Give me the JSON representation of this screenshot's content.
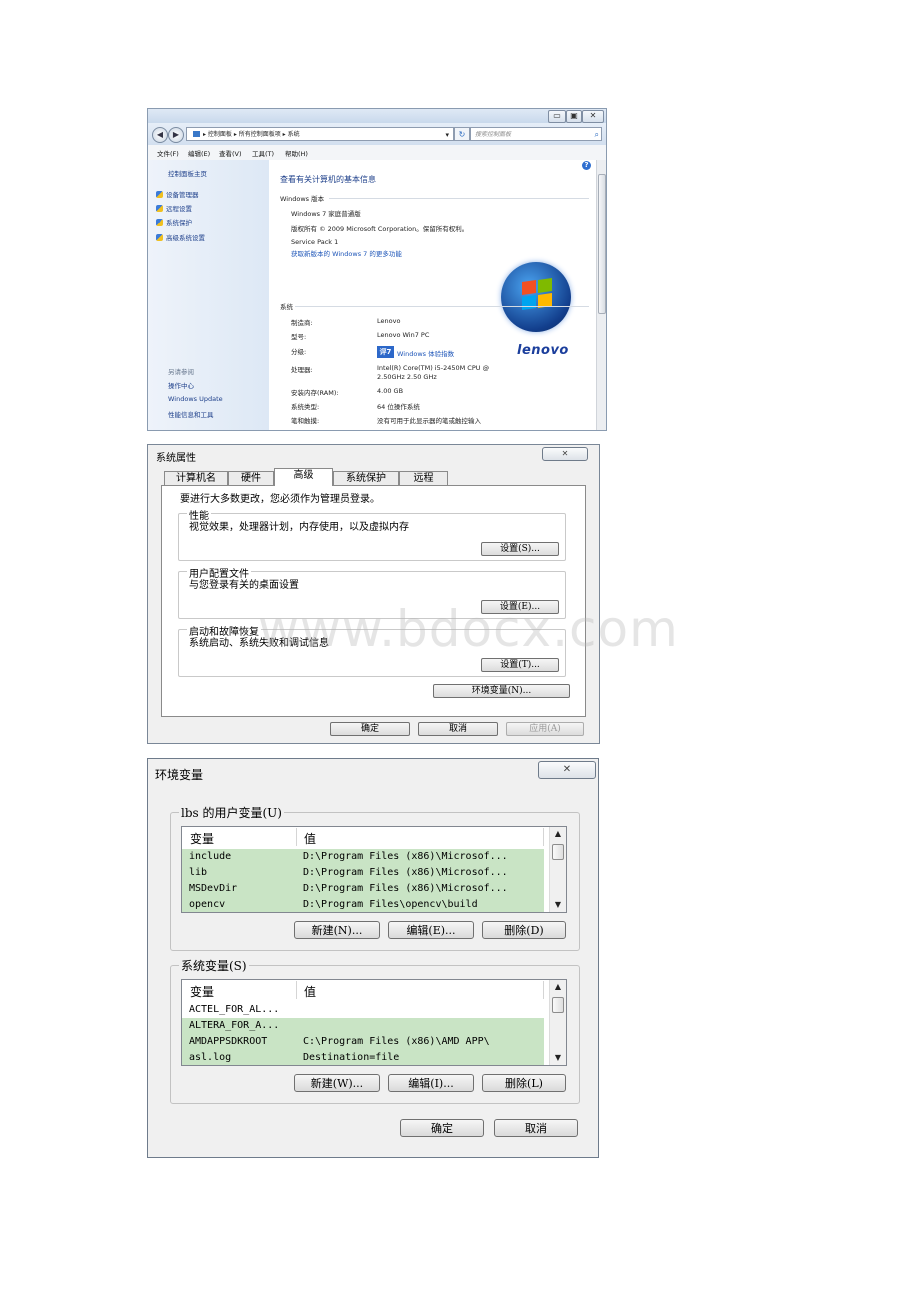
{
  "window1": {
    "caption": {
      "minimize": "▭",
      "maximize": "▣",
      "close": "✕"
    },
    "nav": {
      "back": "◀",
      "forward": "▶",
      "recent": "▾"
    },
    "address_path": "▸ 控制面板 ▸ 所有控制面板项 ▸ 系统",
    "search_placeholder": "搜索控制面板",
    "menu": [
      "文件(F)",
      "编辑(E)",
      "查看(V)",
      "工具(T)",
      "帮助(H)"
    ],
    "sidebar": {
      "home": "控制面板主页",
      "links": [
        "设备管理器",
        "远程设置",
        "系统保护",
        "高级系统设置"
      ],
      "see_also": "另请参阅",
      "bottom_links": [
        "操作中心",
        "Windows Update",
        "性能信息和工具"
      ]
    },
    "title": "查看有关计算机的基本信息",
    "edition_header": "Windows 版本",
    "edition": "Windows 7 家庭普通版",
    "copyright": "版权所有 © 2009 Microsoft Corporation。保留所有权利。",
    "service_pack": "Service Pack 1",
    "upgrade_link": "获取新版本的 Windows 7 的更多功能",
    "system_header": "系统",
    "system_rows": [
      {
        "label": "制造商:",
        "value": "Lenovo"
      },
      {
        "label": "型号:",
        "value": "Lenovo Win7 PC"
      },
      {
        "label": "分级:",
        "value": "Windows 体验指数"
      },
      {
        "label": "处理器:",
        "value": "Intel(R) Core(TM) i5-2450M CPU @ 2.50GHz   2.50 GHz"
      },
      {
        "label": "安装内存(RAM):",
        "value": "4.00 GB"
      },
      {
        "label": "系统类型:",
        "value": "64 位操作系统"
      },
      {
        "label": "笔和触摸:",
        "value": "没有可用于此显示器的笔或触控输入"
      }
    ],
    "processor_line1": "Intel(R) Core(TM) i5-2450M CPU @",
    "processor_line2": "2.50GHz   2.50 GHz",
    "wei_badge": "评7",
    "logo_text": "lenovo",
    "help_icon": "?"
  },
  "window2": {
    "title": "系统属性",
    "close": "✕",
    "tabs": [
      "计算机名",
      "硬件",
      "高级",
      "系统保护",
      "远程"
    ],
    "notice": "要进行大多数更改，您必须作为管理员登录。",
    "groups": [
      {
        "label": "性能",
        "desc": "视觉效果，处理器计划，内存使用，以及虚拟内存",
        "button": "设置(S)..."
      },
      {
        "label": "用户配置文件",
        "desc": "与您登录有关的桌面设置",
        "button": "设置(E)..."
      },
      {
        "label": "启动和故障恢复",
        "desc": "系统启动、系统失败和调试信息",
        "button": "设置(T)..."
      }
    ],
    "env_button": "环境变量(N)...",
    "ok": "确定",
    "cancel": "取消",
    "apply": "应用(A)"
  },
  "window3": {
    "title": "环境变量",
    "close": "✕",
    "user_group": "lbs 的用户变量(U)",
    "col_var": "变量",
    "col_val": "值",
    "user_vars": [
      {
        "name": "include",
        "value": "D:\\Program Files (x86)\\Microsof..."
      },
      {
        "name": "lib",
        "value": "D:\\Program Files (x86)\\Microsof..."
      },
      {
        "name": "MSDevDir",
        "value": "D:\\Program Files (x86)\\Microsof..."
      },
      {
        "name": "opencv",
        "value": "D:\\Program Files\\opencv\\build"
      }
    ],
    "user_buttons": [
      "新建(N)...",
      "编辑(E)...",
      "删除(D)"
    ],
    "system_group": "系统变量(S)",
    "system_vars": [
      {
        "name": "ACTEL_FOR_AL...",
        "value": ""
      },
      {
        "name": "ALTERA_FOR_A...",
        "value": ""
      },
      {
        "name": "AMDAPPSDKROOT",
        "value": "C:\\Program Files (x86)\\AMD APP\\"
      },
      {
        "name": "asl.log",
        "value": "Destination=file"
      }
    ],
    "system_buttons": [
      "新建(W)...",
      "编辑(I)...",
      "删除(L)"
    ],
    "ok": "确定",
    "cancel": "取消"
  },
  "watermark": "www.bdocx.com",
  "colors": {
    "selection": "#c9e4c5",
    "link": "#1d55b8",
    "lenovo": "#1b3e9c"
  }
}
